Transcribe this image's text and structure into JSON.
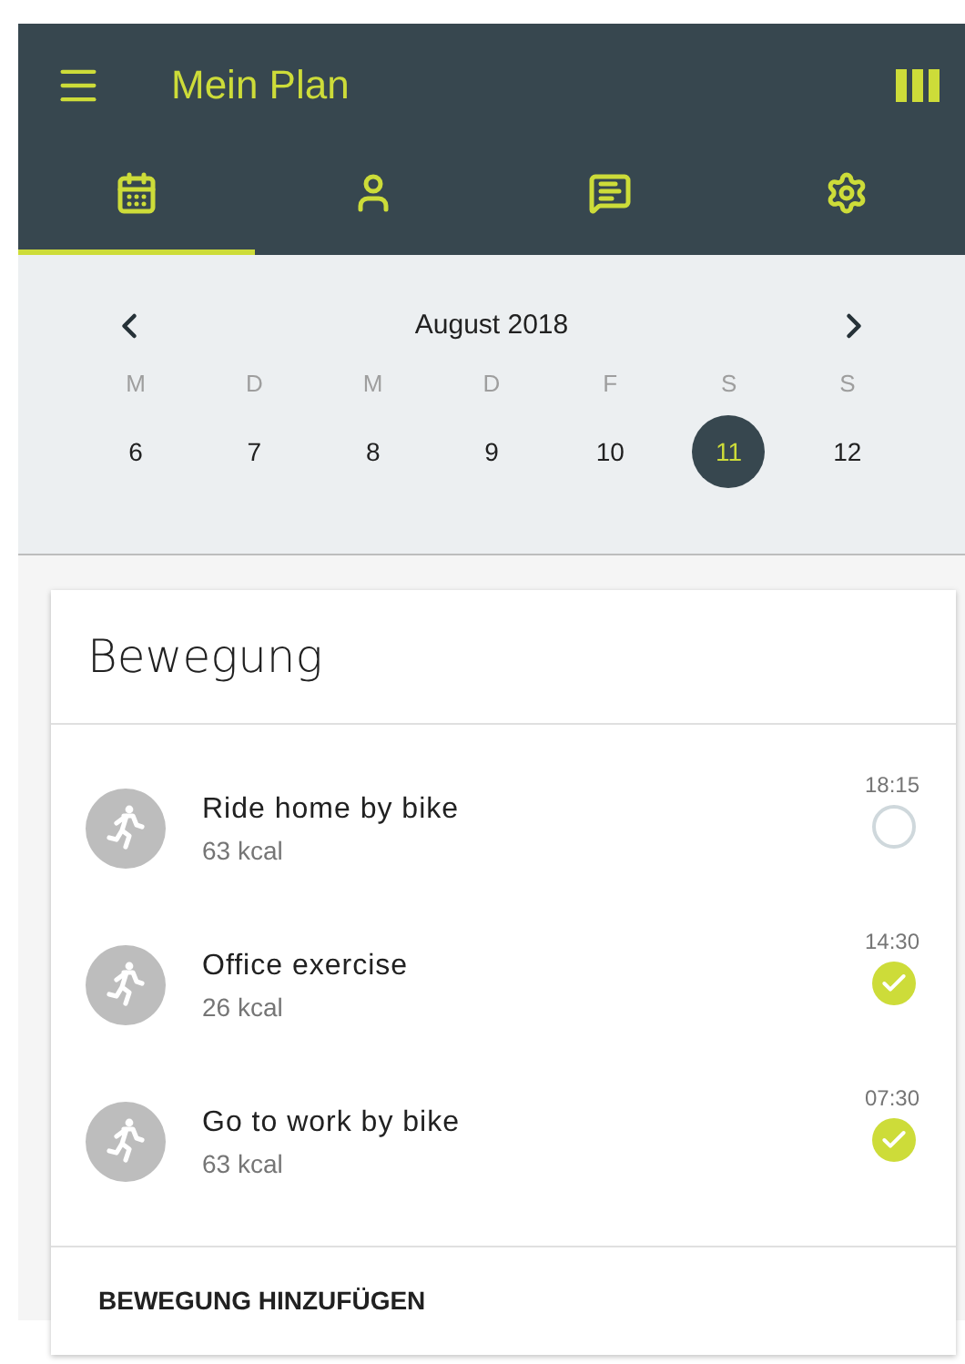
{
  "app_bar": {
    "title": "Mein Plan"
  },
  "tabs": [
    {
      "selected": true
    },
    {
      "selected": false
    },
    {
      "selected": false
    },
    {
      "selected": false
    }
  ],
  "calendar": {
    "month": "August 2018",
    "days": [
      {
        "weekday": "M",
        "date": "6",
        "selected": false
      },
      {
        "weekday": "D",
        "date": "7",
        "selected": false
      },
      {
        "weekday": "M",
        "date": "8",
        "selected": false
      },
      {
        "weekday": "D",
        "date": "9",
        "selected": false
      },
      {
        "weekday": "F",
        "date": "10",
        "selected": false
      },
      {
        "weekday": "S",
        "date": "11",
        "selected": true
      },
      {
        "weekday": "S",
        "date": "12",
        "selected": false
      }
    ]
  },
  "card": {
    "title": "Bewegung",
    "items": [
      {
        "name": "Ride home by bike",
        "energy": "63 kcal",
        "time": "18:15",
        "done": false
      },
      {
        "name": "Office exercise",
        "energy": "26 kcal",
        "time": "14:30",
        "done": true
      },
      {
        "name": "Go to work by bike",
        "energy": "63 kcal",
        "time": "07:30",
        "done": true
      }
    ],
    "action": "BEWEGUNG HINZUFÜGEN"
  }
}
